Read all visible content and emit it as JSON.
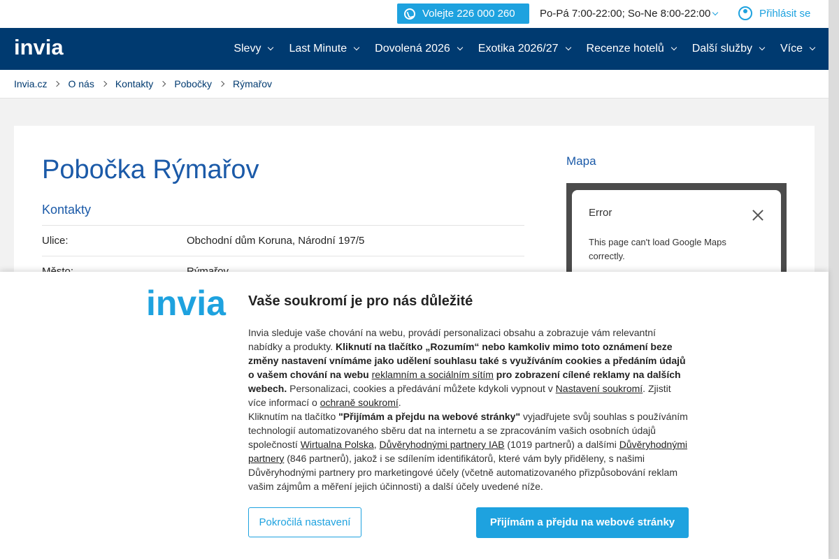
{
  "topbar": {
    "phone_label": "Volejte 226 000 260",
    "hours": "Po-Pá 7:00-22:00; So-Ne 8:00-22:00",
    "login_label": "Přihlásit se"
  },
  "brand": {
    "logo_text": "invia",
    "accent": "#1ea2df",
    "nav_bg": "#003a70"
  },
  "nav": {
    "items": [
      {
        "label": "Slevy"
      },
      {
        "label": "Last Minute"
      },
      {
        "label": "Dovolená 2026"
      },
      {
        "label": "Exotika 2026/27"
      },
      {
        "label": "Recenze hotelů"
      },
      {
        "label": "Další služby"
      },
      {
        "label": "Více"
      }
    ]
  },
  "breadcrumb": [
    "Invia.cz",
    "O nás",
    "Kontakty",
    "Pobočky",
    "Rýmařov"
  ],
  "main": {
    "title": "Pobočka Rýmařov",
    "section_title": "Kontakty",
    "rows": [
      {
        "key": "Ulice:",
        "value": "Obchodní dům Koruna, Národní 197/5"
      },
      {
        "key": "Město:",
        "value": "Rýmařov"
      }
    ]
  },
  "map": {
    "title": "Mapa",
    "error_title": "Error",
    "error_message": "This page can't load Google Maps correctly."
  },
  "consent": {
    "title": "Vaše soukromí je pro nás důležité",
    "p1_a": "Invia sleduje vaše chování na webu, provádí personalizaci obsahu a zobrazuje vám relevantní nabídky a produkty. ",
    "p1_b": "Kliknutí na tlačítko „Rozumím“ nebo kamkoliv mimo toto oznámení beze změny nastavení vnímáme jako udělení souhlasu také s využíváním cookies a předáním údajů o vašem chování na webu ",
    "p1_link1": "reklamním a sociálním sítím",
    "p1_c": " pro zobrazení cílené reklamy na dalších webech.",
    "p1_d": " Personalizaci, cookies a předávání můžete kdykoli vypnout v ",
    "p1_link2": "Nastavení soukromí",
    "p1_e": ". Zjistit více informací o ",
    "p1_link3": " ochraně soukromí",
    "p1_f": ".",
    "p2_a": "Kliknutím na tlačítko ",
    "p2_b": "\"Přijímám a přejdu na webové stránky\"",
    "p2_c": " vyjadřujete svůj souhlas s používáním technologií automatizovaného sběru dat na internetu a se zpracováním vašich osobních údajů společností ",
    "p2_link1": "Wirtualna Polska",
    "p2_d": ", ",
    "p2_link2": "Důvěryhodnými partnery IAB",
    "p2_e": " (1019 partnerů) a dalšími ",
    "p2_link3": "Důvěryhodnými partnery",
    "p2_f": " (846 partnerů), jakož i se sdílením identifikátorů, které vám byly přiděleny, s našimi Důvěryhodnými partnery pro marketingové účely (včetně automatizovaného přizpůsobování reklam vašim zájmům a měření jejich účinnosti) a další účely uvedené níže.",
    "btn_advanced": "Pokročilá nastavení",
    "btn_accept": "Přijímám a přejdu na webové stránky"
  }
}
